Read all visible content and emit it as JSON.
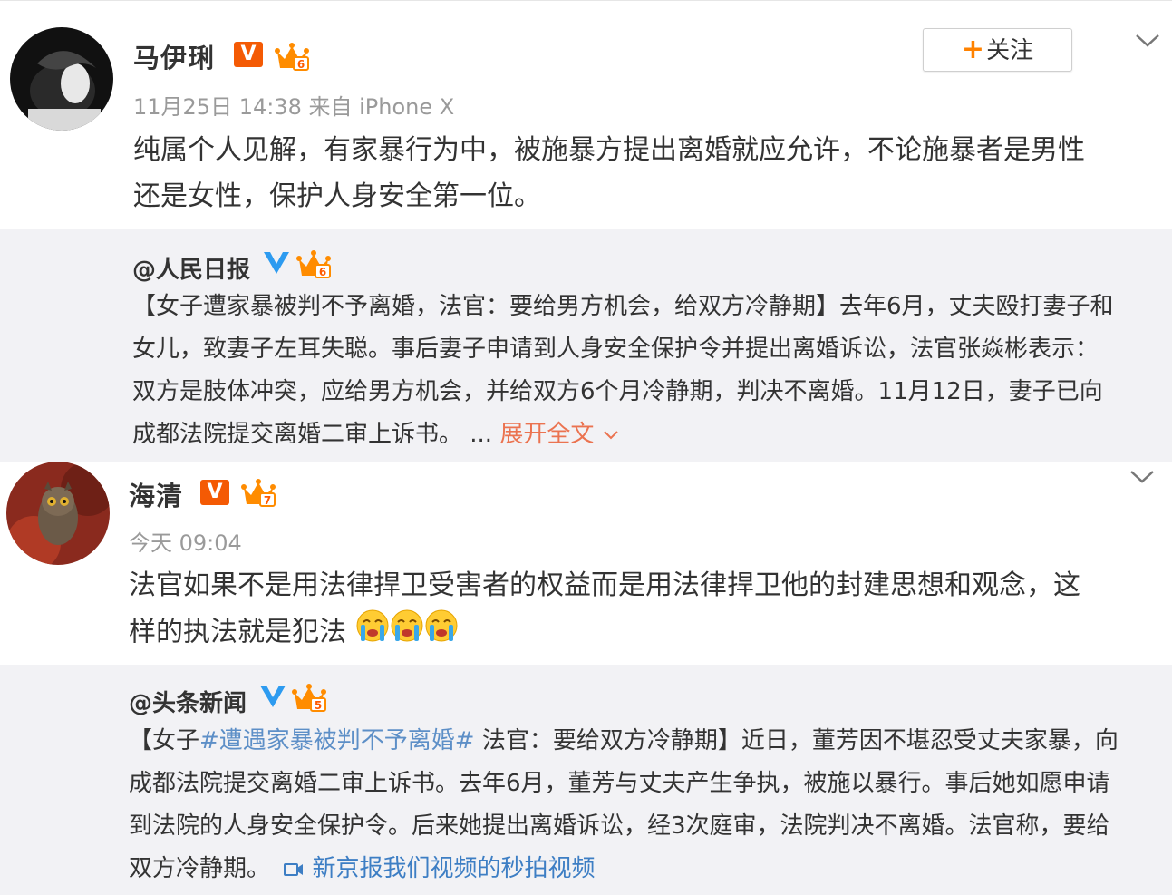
{
  "posts": [
    {
      "author": "马伊琍",
      "meta": "11月25日 14:38 来自 iPhone X",
      "text_line1": "纯属个人见解，有家暴行为中，被施暴方提出离婚就应允许，不论施暴者是男性",
      "text_line2": "还是女性，保护人身安全第一位。",
      "follow_label": "关注",
      "level": "6",
      "repost": {
        "author": "@人民日报",
        "level": "6",
        "line1": "【女子遭家暴被判不予离婚，法官：要给男方机会，给双方冷静期】去年6月，丈夫殴打妻子和",
        "line2": "女儿，致妻子左耳失聪。事后妻子申请到人身安全保护令并提出离婚诉讼，法官张焱彬表示：",
        "line3": "双方是肢体冲突，应给男方机会，并给双方6个月冷静期，判决不离婚。11月12日，妻子已向",
        "line4": "成都法院提交离婚二审上诉书。 ...",
        "expand_label": "展开全文"
      }
    },
    {
      "author": "海清",
      "meta": "今天 09:04",
      "text_line1": "法官如果不是用法律捍卫受害者的权益而是用法律捍卫他的封建思想和观念，这",
      "text_line2": "样的执法就是犯法",
      "level": "7",
      "repost": {
        "author": "@头条新闻",
        "level": "5",
        "line1_prefix": "【女子",
        "line1_topic": "#遭遇家暴被判不予离婚#",
        "line1_suffix": " 法官：要给双方冷静期】近日，董芳因不堪忍受丈夫家暴，向",
        "line2": "成都法院提交离婚二审上诉书。去年6月，董芳与丈夫产生争执，被施以暴行。事后她如愿申请",
        "line3": "到法院的人身安全保护令。后来她提出离婚诉讼，经3次庭审，法院判决不离婚。法官称，要给",
        "line4": "双方冷静期。",
        "video_link": "新京报我们视频的秒拍视频"
      }
    }
  ],
  "icons": {
    "verified_orange": "V",
    "verified_blue": "V"
  },
  "colors": {
    "orange_badge": "#f45a04",
    "repost_bg": "#f2f2f5",
    "link": "#eb7350",
    "topic": "#5d8fc7"
  }
}
